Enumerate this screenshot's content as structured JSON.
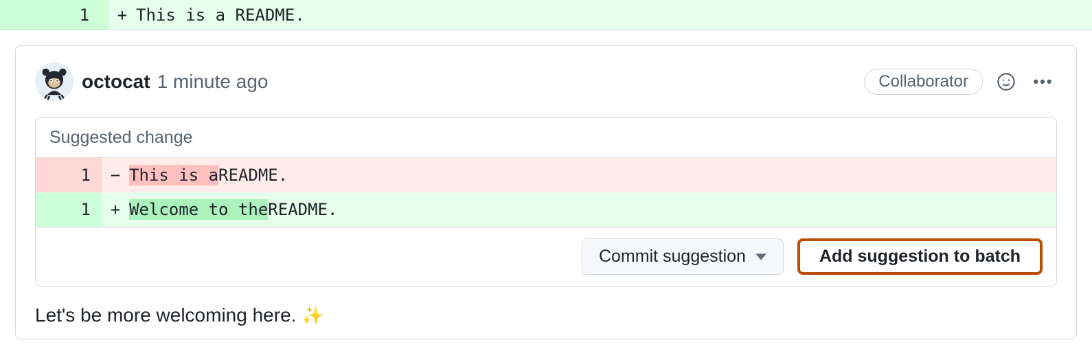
{
  "diff_top": {
    "line_number": "1",
    "marker": "+",
    "code": "This is a README."
  },
  "comment": {
    "author": "octocat",
    "timestamp": "1 minute ago",
    "badge": "Collaborator"
  },
  "suggestion": {
    "header": "Suggested change",
    "lines": [
      {
        "ln": "1",
        "marker": "−",
        "highlight": "This is a",
        "rest": " README."
      },
      {
        "ln": "1",
        "marker": "+",
        "highlight": "Welcome to the",
        "rest": " README."
      }
    ],
    "commit_button": "Commit suggestion",
    "batch_button": "Add suggestion to batch"
  },
  "body_text": "Let's be more welcoming here. ",
  "body_emoji": "✨"
}
